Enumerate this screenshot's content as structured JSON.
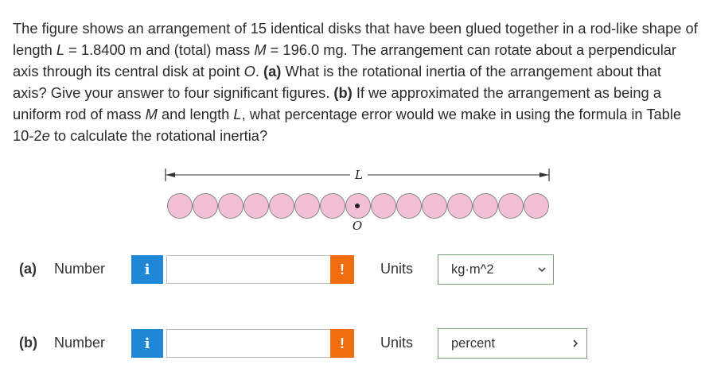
{
  "question": {
    "seg1": "The figure shows an arrangement of 15 identical disks that have been glued together in a rod-like shape of length ",
    "L_symbol": "L",
    "seg2": " = 1.8400 m and (total) mass ",
    "M_symbol": "M",
    "seg3": " = 196.0 mg. The arrangement can rotate about a perpendicular axis through its central disk at point ",
    "O_symbol": "O",
    "seg4": ". ",
    "part_a_tag": "(a)",
    "seg5": " What is the rotational inertia of the arrangement about that axis? Give your answer to four significant figures. ",
    "part_b_tag": "(b)",
    "seg6": " If we approximated the arrangement as being a uniform rod of mass ",
    "M_symbol2": "M",
    "seg7": " and length ",
    "L_symbol2": "L",
    "seg8": ", what percentage error would we make in using the formula in Table 10-2",
    "e_symbol": "e",
    "seg9": " to calculate the rotational inertia?"
  },
  "figure": {
    "length_label": "L",
    "point_label": "O",
    "disk_count": 15,
    "disk_fill": "#f2bfd6",
    "disk_stroke": "#888888"
  },
  "answers": [
    {
      "part": "(a)",
      "number_label": "Number",
      "info_glyph": "i",
      "value": "",
      "warn_glyph": "!",
      "units_label": "Units",
      "units_value": "kg·m^2"
    },
    {
      "part": "(b)",
      "number_label": "Number",
      "info_glyph": "i",
      "value": "",
      "warn_glyph": "!",
      "units_label": "Units",
      "units_value": "percent"
    }
  ],
  "colors": {
    "info": "#1e88d6",
    "warning": "#f06d0f",
    "select_border": "#7aa07a"
  }
}
